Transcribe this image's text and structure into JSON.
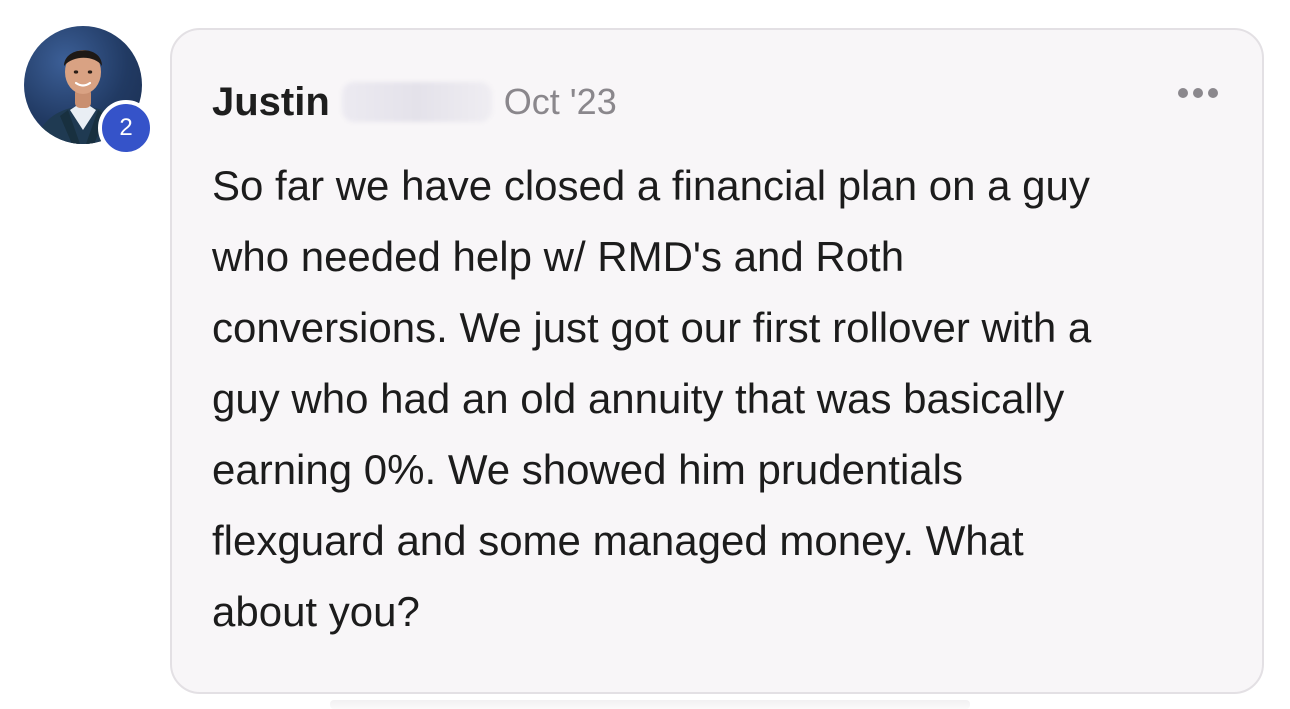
{
  "post": {
    "author_first": "Justin",
    "date": "Oct '23",
    "badge_count": "2",
    "body_lines": [
      "So far we have closed a financial plan on a guy",
      "who needed help w/ RMD's and Roth",
      "conversions. We just got our first rollover with a",
      "guy who had an old annuity that was basically",
      "earning 0%. We showed him prudentials",
      "flexguard and some managed money. What",
      "about you?"
    ],
    "more_icon": "ellipsis-icon"
  },
  "colors": {
    "badge": "#3553c9",
    "card_bg": "#f8f6f8",
    "card_border": "#e3e0e4",
    "date_text": "#8a878c"
  }
}
